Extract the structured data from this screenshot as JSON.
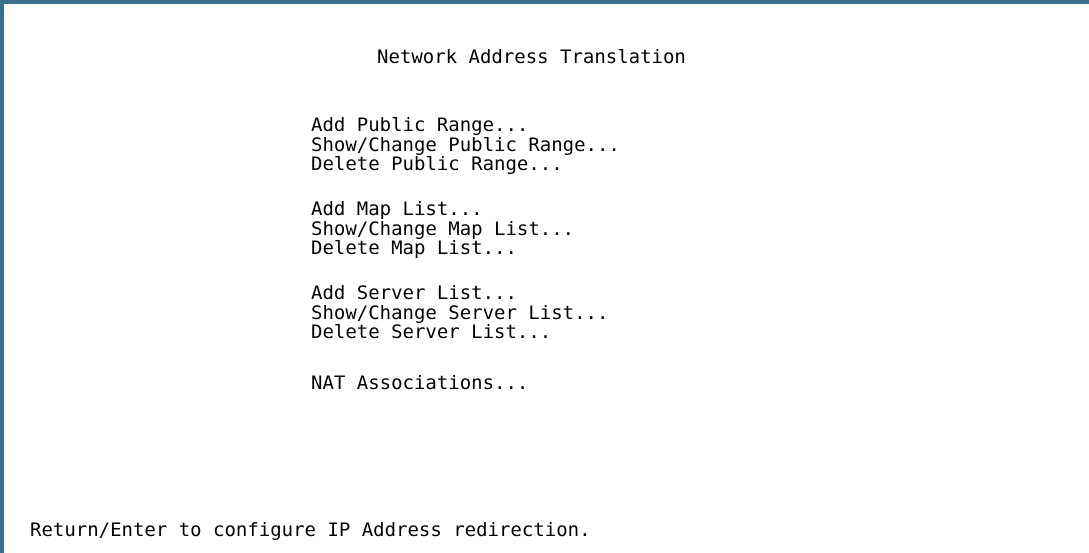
{
  "screen": {
    "title": "Network Address Translation",
    "status_line": "Return/Enter to configure IP Address redirection."
  },
  "menu": {
    "public_range": [
      "Add Public Range...",
      "Show/Change Public Range...",
      "Delete Public Range..."
    ],
    "map_list": [
      "Add Map List...",
      "Show/Change Map List...",
      "Delete Map List..."
    ],
    "server_list": [
      "Add Server List...",
      "Show/Change Server List...",
      "Delete Server List..."
    ],
    "associations": [
      "NAT Associations..."
    ]
  },
  "colors": {
    "border": "#3b6f8c",
    "background": "#ffffff",
    "text": "#000000"
  }
}
